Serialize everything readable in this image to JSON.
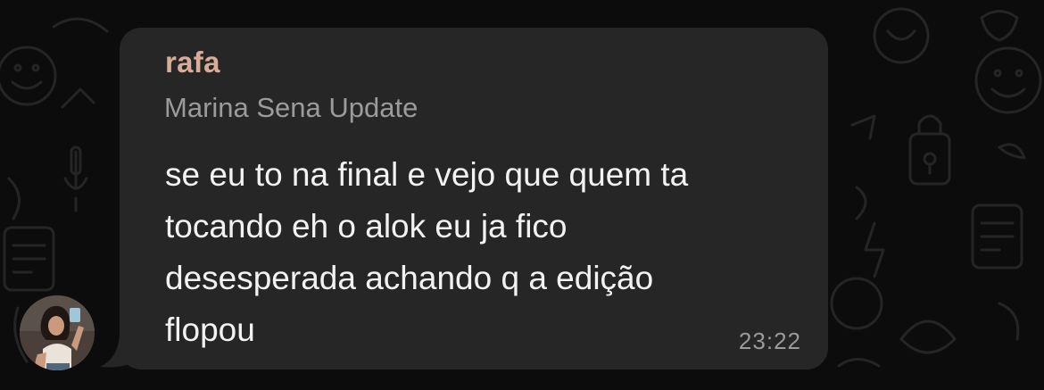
{
  "chat": {
    "background_color": "#0c0c0c",
    "bubble_color": "#262626",
    "accent": "#d9ac97"
  },
  "message": {
    "sender": "rafa",
    "forwarded_from": "Marina Sena Update",
    "lines": [
      "se eu to na final e vejo que quem ta",
      "tocando eh o alok eu ja fico",
      "desesperada achando q a edição",
      "flopou"
    ],
    "time": "23:22"
  },
  "avatar": {
    "icon": "user-photo-avatar"
  }
}
